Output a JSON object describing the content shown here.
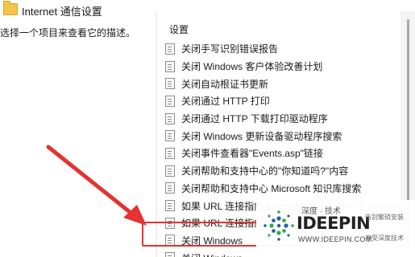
{
  "header": {
    "title": "Internet 通信设置"
  },
  "left_pane": {
    "description": "选择一个项目来查看它的描述。"
  },
  "right_pane": {
    "column_header": "设置",
    "settings": [
      "关闭手写识别错误报告",
      "关闭 Windows 客户体验改善计划",
      "关闭自动根证书更新",
      "关闭通过 HTTP 打印",
      "关闭通过 HTTP 下载打印驱动程序",
      "关闭 Windows 更新设备驱动程序搜索",
      "关闭事件查看器\"Events.asp\"链接",
      "关闭帮助和支持中心的\"你知道吗?\"内容",
      "关闭帮助和支持中心 Microsoft 知识库搜索",
      "如果 URL 连接指向 Microsoft.com，则关闭 Internet",
      "如果 URL 连接指向",
      "关闭 Windows",
      "关闭 Windows"
    ]
  },
  "watermark": {
    "top_text": "深度 · 技术",
    "brand": "IDEEPIN",
    "url": "WWW.IDEEPIN.COM",
    "right_top": "告别繁琐安装",
    "right_bottom": "享受深度技术"
  },
  "colors": {
    "annotation_red": "#e53232",
    "logo_blue": "#1e5fa8",
    "logo_green": "#2fa84a",
    "folder_yellow": "#f3c64a"
  },
  "icons": {
    "folder": "folder-icon",
    "policy": "policy-setting-icon",
    "logo": "ideepin-logo"
  }
}
